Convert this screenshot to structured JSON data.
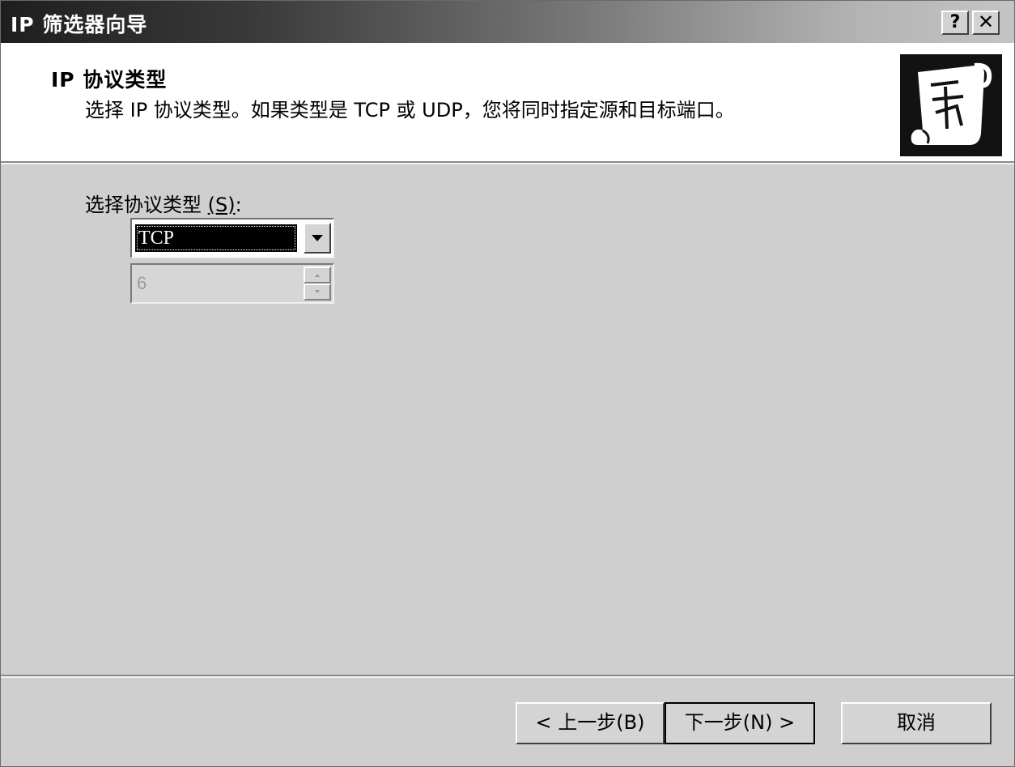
{
  "window": {
    "title": "IP 筛选器向导",
    "help_button": "?",
    "close_button": "✕"
  },
  "header": {
    "title": "IP  协议类型",
    "description": "选择 IP 协议类型。如果类型是 TCP 或 UDP，您将同时指定源和目标端口。",
    "icon": "scroll-wizard-icon"
  },
  "form": {
    "protocol_label": "选择协议类型",
    "protocol_label_accel": "(S)",
    "protocol_label_suffix": ":",
    "protocol_selected": "TCP",
    "protocol_number": "6"
  },
  "buttons": {
    "back": "< 上一步(B)",
    "next": "下一步(N) >",
    "cancel": "取消"
  }
}
